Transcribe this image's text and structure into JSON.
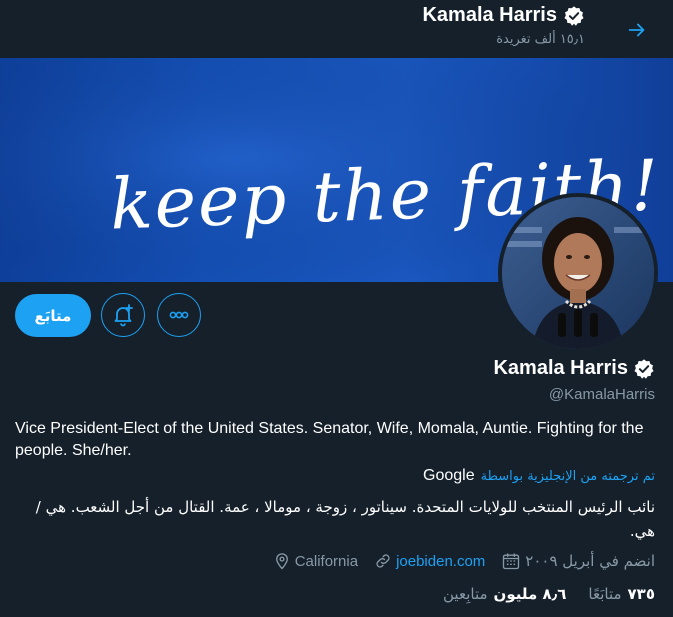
{
  "header": {
    "name": "Kamala Harris",
    "tweet_count": "١٥٫١ ألف تغريدة",
    "back_icon": "arrow-right-icon"
  },
  "banner": {
    "text": "keep the faith!"
  },
  "actions": {
    "follow_label": "متابَع",
    "notify_icon": "bell-plus-icon",
    "more_icon": "more-icon"
  },
  "profile": {
    "name": "Kamala Harris",
    "handle": "@KamalaHarris",
    "bio_en": "Vice President-Elect of the United States. Senator, Wife, Momala, Auntie. Fighting for the people. She/her.",
    "translated_label": "تم ترجمته من الإنجليزية بواسطة",
    "translator": "Google",
    "bio_ar": "نائب الرئيس المنتخب للولايات المتحدة. سيناتور ، زوجة ، مومالا ، عمة. القتال من أجل الشعب. هي / هي."
  },
  "meta": {
    "joined": "انضم في أبريل ٢٠٠٩",
    "link": "joebiden.com",
    "location": "California"
  },
  "stats": {
    "following_num": "٧٣٥",
    "following_label": "متابَعًا",
    "followers_num": "٨٫٦ مليون",
    "followers_label": "متابِعين"
  },
  "colors": {
    "background": "#15202b",
    "accent": "#1da1f2",
    "muted": "#8899a6"
  }
}
